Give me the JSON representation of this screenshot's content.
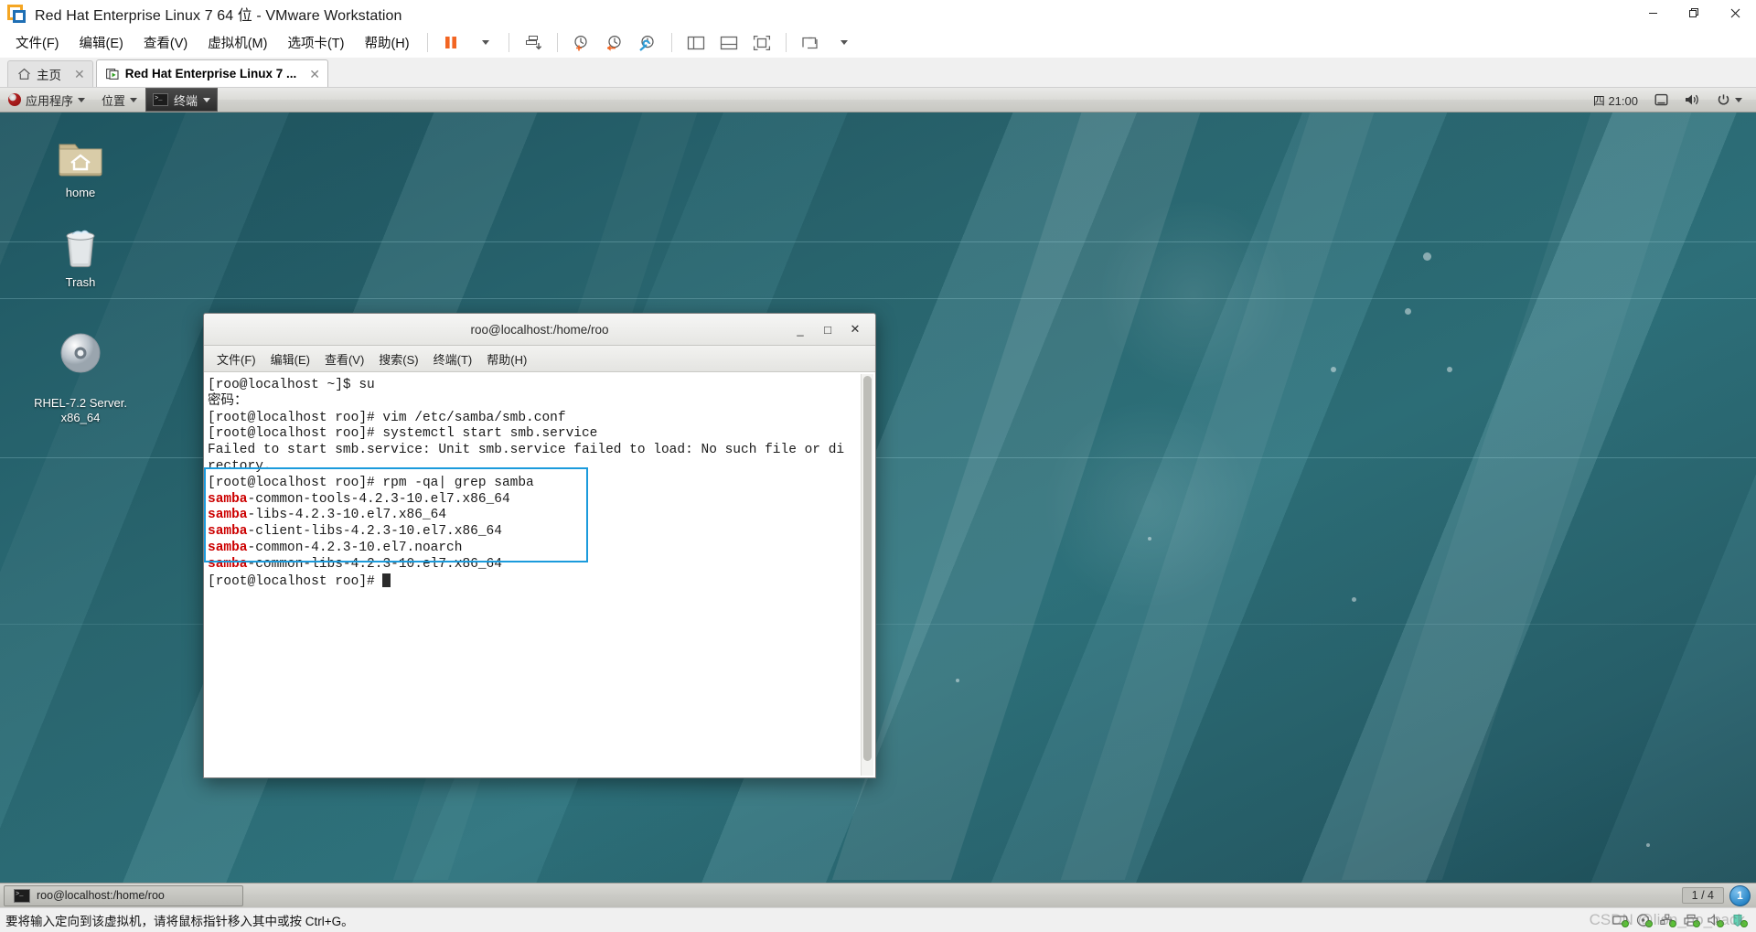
{
  "window": {
    "title": "Red Hat Enterprise Linux 7 64 位 - VMware Workstation",
    "minimize_label": "最小化",
    "restore_label": "还原",
    "close_label": "关闭"
  },
  "menubar": {
    "items": [
      {
        "label": "文件(F)"
      },
      {
        "label": "编辑(E)"
      },
      {
        "label": "查看(V)"
      },
      {
        "label": "虚拟机(M)"
      },
      {
        "label": "选项卡(T)"
      },
      {
        "label": "帮助(H)"
      }
    ]
  },
  "toolbar": {
    "suspend_label": "挂起",
    "suspend_dropdown_label": "电源选项",
    "snapshot_manager_label": "管理快照",
    "take_snapshot_label": "拍摄此虚拟机的快照",
    "revert_snapshot_label": "恢复到上一个快照",
    "edit_snapshot_label": "管理快照",
    "show_library_label": "显示或隐藏库",
    "show_console_label": "显示或隐藏控制台视图",
    "fullscreen_label": "进入全屏模式",
    "unity_label": "Unity 模式",
    "unity_dropdown_label": "显示选项"
  },
  "tabs": [
    {
      "label": "主页",
      "icon": "home-icon",
      "active": false,
      "closable": true
    },
    {
      "label": "Red Hat Enterprise Linux 7 ...",
      "icon": "vm-running-icon",
      "active": true,
      "closable": true
    }
  ],
  "guest": {
    "panel": {
      "applications": "应用程序",
      "places": "位置",
      "active_window": "终端",
      "clock": "四 21:00",
      "notification_label": "通知",
      "volume_label": "音量",
      "power_label": "系统"
    },
    "desktop_icons": [
      {
        "label": "home",
        "icon": "folder-home-icon"
      },
      {
        "label": "Trash",
        "icon": "trash-icon"
      },
      {
        "label": "RHEL-7.2 Server.\nx86_64",
        "icon": "disc-icon"
      }
    ],
    "terminal": {
      "title": "roo@localhost:/home/roo",
      "menu": [
        "文件(F)",
        "编辑(E)",
        "查看(V)",
        "搜索(S)",
        "终端(T)",
        "帮助(H)"
      ],
      "minimize": "_",
      "maximize": "□",
      "close": "✕",
      "lines": [
        {
          "text": "[roo@localhost ~]$ su"
        },
        {
          "text": "密码："
        },
        {
          "text": "[root@localhost roo]# vim /etc/samba/smb.conf"
        },
        {
          "text": "[root@localhost roo]# systemctl start smb.service"
        },
        {
          "text": "Failed to start smb.service: Unit smb.service failed to load: No such file or di"
        },
        {
          "text": "rectory."
        },
        {
          "text": "[root@localhost roo]# rpm -qa| grep samba"
        },
        {
          "prefix": "samba",
          "text": "-common-tools-4.2.3-10.el7.x86_64"
        },
        {
          "prefix": "samba",
          "text": "-libs-4.2.3-10.el7.x86_64"
        },
        {
          "prefix": "samba",
          "text": "-client-libs-4.2.3-10.el7.x86_64"
        },
        {
          "prefix": "samba",
          "text": "-common-4.2.3-10.el7.noarch"
        },
        {
          "prefix": "samba",
          "text": "-common-libs-4.2.3-10.el7.x86_64"
        },
        {
          "text": "[root@localhost roo]# "
        }
      ],
      "highlight_color": "#1b9bdc",
      "prefix_color": "#cc0000"
    },
    "taskbar": {
      "window_button": "roo@localhost:/home/roo",
      "workspace_count": "1 / 4",
      "workspace_current": "1"
    }
  },
  "statusbar": {
    "hint": "要将输入定向到该虚拟机，请将鼠标指针移入其中或按 Ctrl+G。",
    "devices": [
      "hdd-icon",
      "cd-icon",
      "network-icon",
      "printer-icon",
      "sound-icon",
      "usb-icon"
    ],
    "watermark": "CSDN @lion_no_back"
  },
  "colors": {
    "accent": "#1b9bdc",
    "desktop": "#2b6a74",
    "vmware_orange": "#f26522",
    "red": "#cc0000"
  }
}
